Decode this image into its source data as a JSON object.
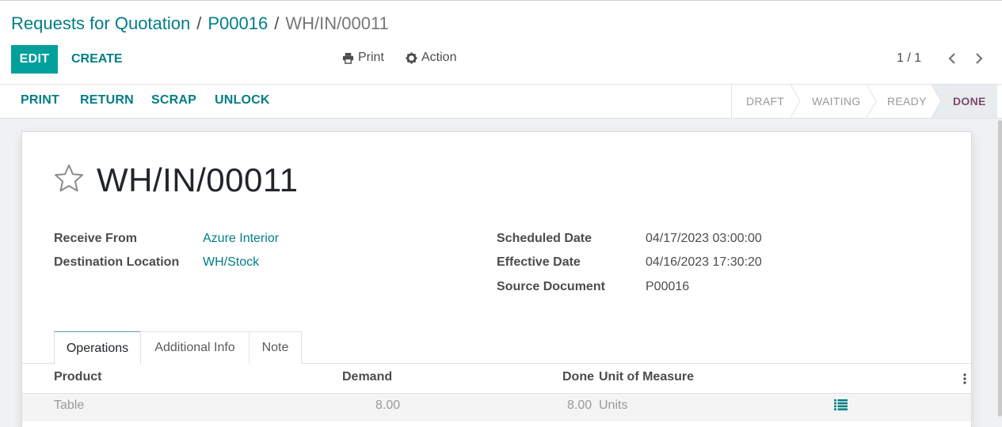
{
  "breadcrumb": [
    {
      "label": "Requests for Quotation",
      "link": true
    },
    {
      "label": "P00016",
      "link": true
    },
    {
      "label": "WH/IN/00011",
      "link": false
    }
  ],
  "breadcrumb_separator": "/",
  "toolbar": {
    "edit_label": "EDIT",
    "create_label": "CREATE",
    "print_label": "Print",
    "action_label": "Action",
    "print_icon": "printer-icon",
    "action_icon": "gear-icon"
  },
  "pager": {
    "value": "1 / 1"
  },
  "statusbar": {
    "buttons": [
      "PRINT",
      "RETURN",
      "SCRAP",
      "UNLOCK"
    ],
    "stages": [
      "DRAFT",
      "WAITING",
      "READY",
      "DONE"
    ],
    "current_stage": "DONE"
  },
  "record": {
    "name": "WH/IN/00011",
    "fields_left": [
      {
        "label": "Receive From",
        "value": "Azure Interior"
      },
      {
        "label": "Destination Location",
        "value": "WH/Stock"
      }
    ],
    "fields_right": [
      {
        "label": "Scheduled Date",
        "value": "04/17/2023 03:00:00"
      },
      {
        "label": "Effective Date",
        "value": "04/16/2023 17:30:20"
      },
      {
        "label": "Source Document",
        "value": "P00016"
      }
    ]
  },
  "tabs": [
    "Operations",
    "Additional Info",
    "Note"
  ],
  "table": {
    "headers": [
      "Product",
      "Demand",
      "Done",
      "Unit of Measure"
    ],
    "rows": [
      {
        "product": "Table",
        "demand": "8.00",
        "done": "8.00",
        "uom": "Units"
      }
    ]
  },
  "colors": {
    "brand": "#00a09d",
    "link": "#017e84",
    "done_stage": "#7c4b6a"
  }
}
